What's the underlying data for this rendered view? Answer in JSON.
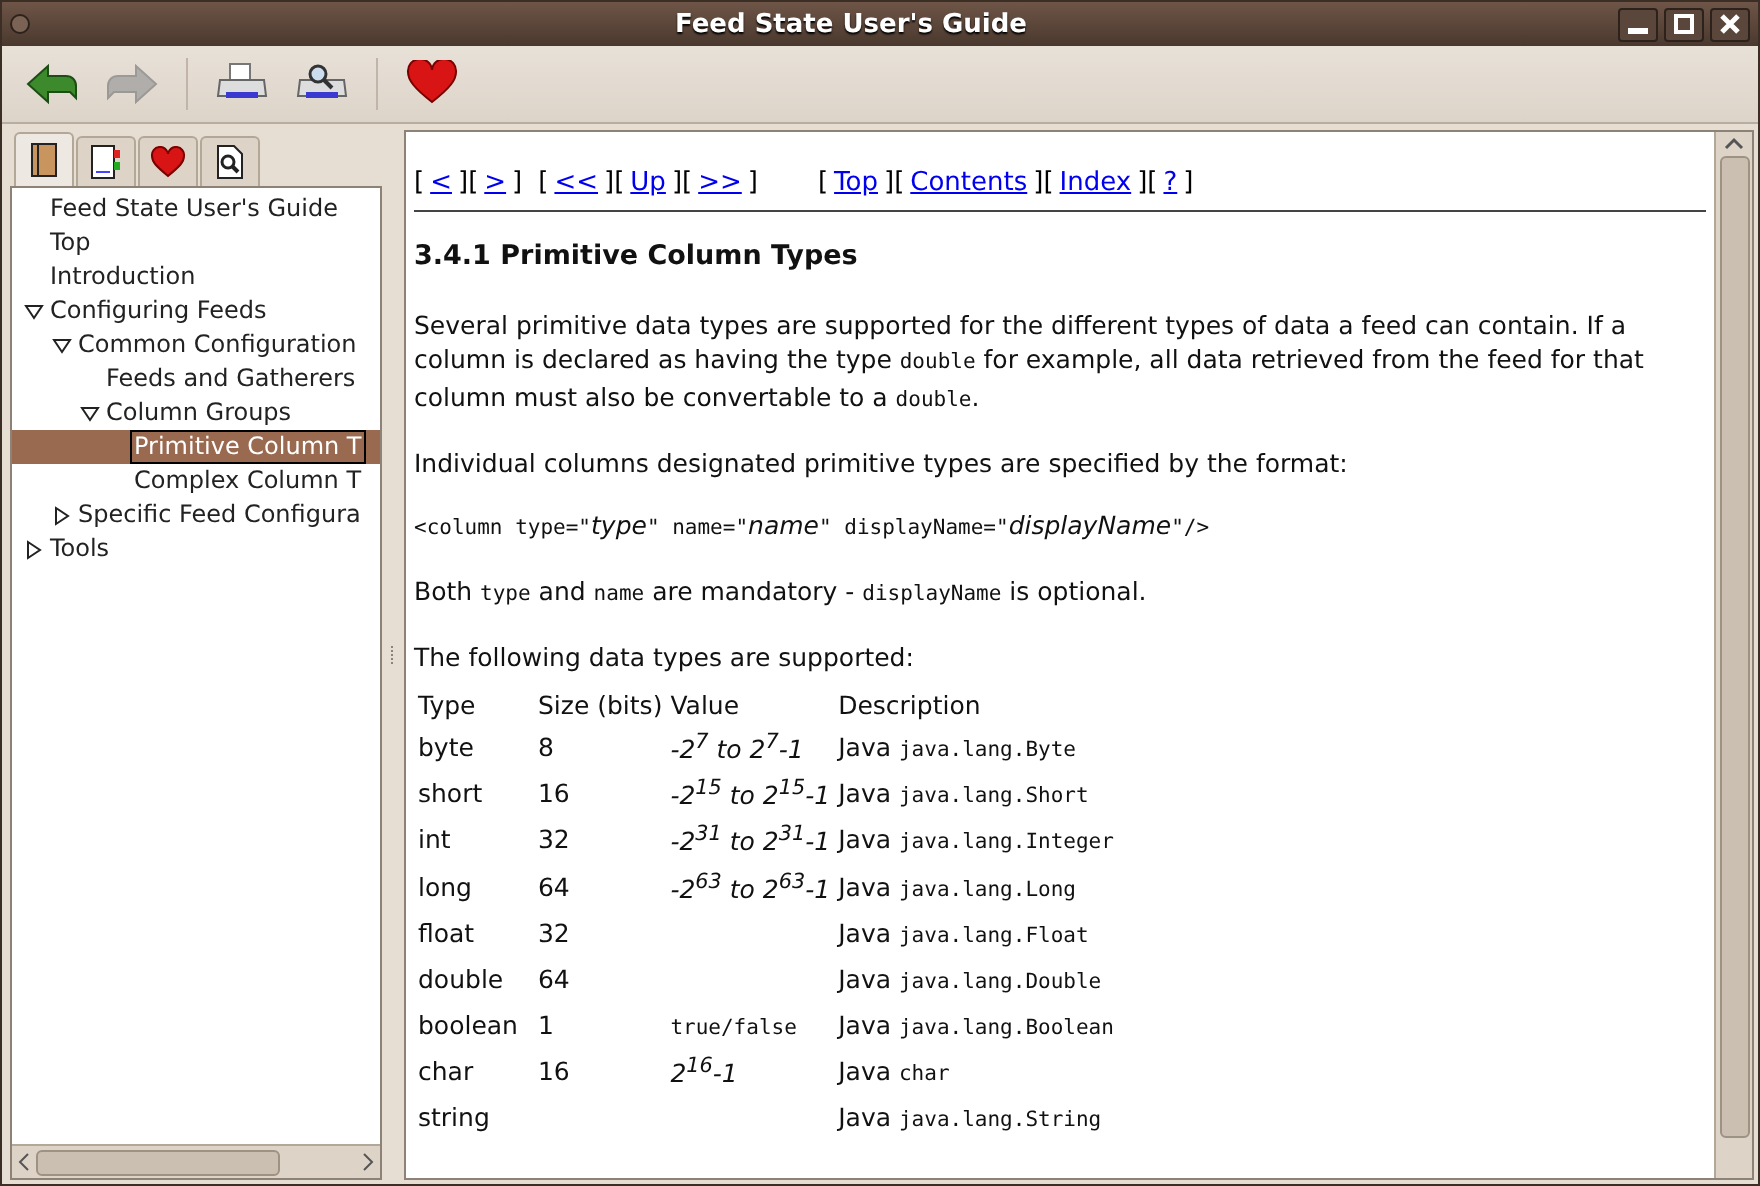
{
  "window": {
    "title": "Feed State User's Guide"
  },
  "toolbar": [
    {
      "kind": "back",
      "disabled": false
    },
    {
      "kind": "forward",
      "disabled": true
    },
    {
      "kind": "separator"
    },
    {
      "kind": "print",
      "disabled": false
    },
    {
      "kind": "preview",
      "disabled": false
    },
    {
      "kind": "separator"
    },
    {
      "kind": "favorite",
      "disabled": false
    }
  ],
  "sidebar": {
    "tabs": [
      {
        "kind": "contents",
        "selected": true
      },
      {
        "kind": "bookmarks",
        "selected": false
      },
      {
        "kind": "favorites",
        "selected": false
      },
      {
        "kind": "search",
        "selected": false
      }
    ],
    "tree": [
      {
        "label": "Feed State User's Guide",
        "selected": false
      },
      {
        "label": "Top",
        "selected": false
      },
      {
        "label": "Introduction",
        "selected": false
      },
      {
        "label": "Configuring Feeds",
        "selected": false,
        "expanded": true,
        "children": [
          {
            "label": "Common Configuration",
            "selected": false,
            "expanded": true,
            "children": [
              {
                "label": "Feeds and Gatherers",
                "selected": false
              },
              {
                "label": "Column Groups",
                "selected": false,
                "expanded": true,
                "children": [
                  {
                    "label": "Primitive Column T",
                    "selected": true
                  },
                  {
                    "label": "Complex Column T",
                    "selected": false
                  }
                ]
              }
            ]
          },
          {
            "label": "Specific Feed Configura",
            "selected": false,
            "expanded": false
          }
        ]
      },
      {
        "label": "Tools",
        "selected": false,
        "expanded": false
      }
    ]
  },
  "nav": [
    {
      "kind": "bracket",
      "text": "["
    },
    {
      "kind": "link",
      "text": "<"
    },
    {
      "kind": "bracket",
      "text": "]"
    },
    {
      "kind": "bracket",
      "text": "["
    },
    {
      "kind": "link",
      "text": ">"
    },
    {
      "kind": "bracket",
      "text": "]"
    },
    {
      "kind": "gap"
    },
    {
      "kind": "bracket",
      "text": "["
    },
    {
      "kind": "link",
      "text": "<<"
    },
    {
      "kind": "bracket",
      "text": "]"
    },
    {
      "kind": "bracket",
      "text": "["
    },
    {
      "kind": "link",
      "text": "Up"
    },
    {
      "kind": "bracket",
      "text": "]"
    },
    {
      "kind": "bracket",
      "text": "["
    },
    {
      "kind": "link",
      "text": ">>"
    },
    {
      "kind": "bracket",
      "text": "]"
    },
    {
      "kind": "wide_gap"
    },
    {
      "kind": "bracket",
      "text": "["
    },
    {
      "kind": "link",
      "text": "Top"
    },
    {
      "kind": "bracket",
      "text": "]"
    },
    {
      "kind": "bracket",
      "text": "["
    },
    {
      "kind": "link",
      "text": "Contents"
    },
    {
      "kind": "bracket",
      "text": "]"
    },
    {
      "kind": "bracket",
      "text": "["
    },
    {
      "kind": "link",
      "text": "Index"
    },
    {
      "kind": "bracket",
      "text": "]"
    },
    {
      "kind": "bracket",
      "text": "["
    },
    {
      "kind": "link",
      "text": "?"
    },
    {
      "kind": "bracket",
      "text": "]"
    }
  ],
  "heading": "3.4.1 Primitive Column Types",
  "paragraphs": [
    [
      {
        "kind": "text",
        "text": "Several primitive data types are supported for the different types of data a feed can contain. If a column is declared as having the type "
      },
      {
        "kind": "code",
        "text": "double"
      },
      {
        "kind": "text",
        "text": " for example, all data retrieved from the feed for that column must also be convertable to a "
      },
      {
        "kind": "code",
        "text": "double"
      },
      {
        "kind": "text",
        "text": "."
      }
    ],
    [
      {
        "kind": "text",
        "text": "Individual columns designated primitive types are specified by the format:"
      }
    ],
    [
      {
        "kind": "code",
        "text": "<column type=\""
      },
      {
        "kind": "italic",
        "text": "type"
      },
      {
        "kind": "code",
        "text": "\" name=\""
      },
      {
        "kind": "italic",
        "text": "name"
      },
      {
        "kind": "code",
        "text": "\" displayName=\""
      },
      {
        "kind": "italic",
        "text": "displayName"
      },
      {
        "kind": "code",
        "text": "\"/>"
      }
    ],
    [
      {
        "kind": "text",
        "text": "Both "
      },
      {
        "kind": "code",
        "text": "type"
      },
      {
        "kind": "text",
        "text": " and "
      },
      {
        "kind": "code",
        "text": "name"
      },
      {
        "kind": "text",
        "text": " are mandatory - "
      },
      {
        "kind": "code",
        "text": "displayName"
      },
      {
        "kind": "text",
        "text": " is optional."
      }
    ],
    [
      {
        "kind": "text",
        "text": "The following data types are supported:"
      }
    ]
  ],
  "table": {
    "columns": [
      "Type",
      "Size (bits)",
      "Value",
      "Description"
    ],
    "rows": [
      {
        "type": "byte",
        "size": "8",
        "value": "-2$^{7}$ to 2$^{7}$-1",
        "lang": "Java",
        "code": "java.lang.Byte"
      },
      {
        "type": "short",
        "size": "16",
        "value": "-2$^{15}$ to 2$^{15}$-1",
        "lang": "Java",
        "code": "java.lang.Short"
      },
      {
        "type": "int",
        "size": "32",
        "value": "-2$^{31}$ to 2$^{31}$-1",
        "lang": "Java",
        "code": "java.lang.Integer"
      },
      {
        "type": "long",
        "size": "64",
        "value": "-2$^{63}$ to 2$^{63}$-1",
        "lang": "Java",
        "code": "java.lang.Long"
      },
      {
        "type": "float",
        "size": "32",
        "lang": "Java",
        "code": "java.lang.Float"
      },
      {
        "type": "double",
        "size": "64",
        "lang": "Java",
        "code": "java.lang.Double"
      },
      {
        "type": "boolean",
        "size": "1",
        "value_code": "true/false",
        "lang": "Java",
        "code": "java.lang.Boolean"
      },
      {
        "type": "char",
        "size": "16",
        "value": "2$^{16}$-1",
        "lang": "Java",
        "code": "char"
      },
      {
        "type": "string",
        "lang": "Java",
        "code": "java.lang.String"
      }
    ]
  }
}
